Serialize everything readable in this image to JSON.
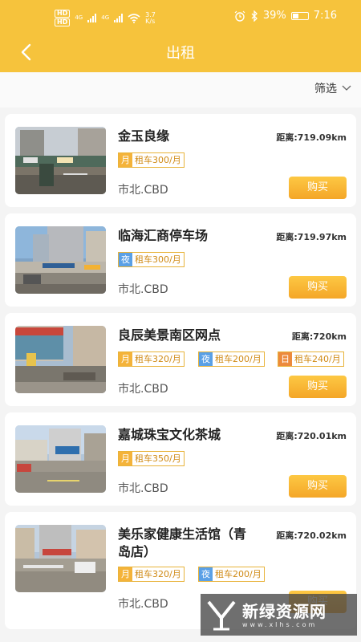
{
  "status_bar": {
    "sim1": "HD",
    "sim2": "HD",
    "net1": "4G",
    "net2": "4G",
    "speed_value": "3.7",
    "speed_unit": "K/s",
    "battery": "39%",
    "time": "7:16",
    "icons": [
      "alarm-icon",
      "bluetooth-icon",
      "battery-icon",
      "wifi-icon",
      "signal-icon"
    ]
  },
  "header": {
    "title": "出租",
    "back_icon": "chevron-left-icon"
  },
  "filter": {
    "label": "筛选",
    "icon": "chevron-down-icon"
  },
  "listings": [
    {
      "name": "金玉良缘",
      "distance": "距离:719.09km",
      "tags": [
        {
          "type": "月",
          "text": "租车300/月",
          "color": "#f4b33a"
        }
      ],
      "location": "市北.CBD",
      "button": "购买"
    },
    {
      "name": "临海汇商停车场",
      "distance": "距离:719.97km",
      "tags": [
        {
          "type": "夜",
          "text": "租车300/月",
          "color": "#5aa0e6"
        }
      ],
      "location": "市北.CBD",
      "button": "购买"
    },
    {
      "name": "良辰美景南区网点",
      "distance": "距离:720km",
      "tags": [
        {
          "type": "月",
          "text": "租车320/月",
          "color": "#f4b33a"
        },
        {
          "type": "夜",
          "text": "租车200/月",
          "color": "#5aa0e6"
        },
        {
          "type": "日",
          "text": "租车240/月",
          "color": "#ec8a3c"
        }
      ],
      "location": "市北.CBD",
      "button": "购买"
    },
    {
      "name": "嘉城珠宝文化茶城",
      "distance": "距离:720.01km",
      "tags": [
        {
          "type": "月",
          "text": "租车350/月",
          "color": "#f4b33a"
        }
      ],
      "location": "市北.CBD",
      "button": "购买"
    },
    {
      "name_line1": "美乐家健康生活馆（青",
      "name_line2": "岛店）",
      "distance": "距离:720.02km",
      "tags": [
        {
          "type": "月",
          "text": "租车320/月",
          "color": "#f4b33a"
        },
        {
          "type": "夜",
          "text": "租车200/月",
          "color": "#5aa0e6"
        }
      ],
      "location": "市北.CBD",
      "button": "购买"
    }
  ],
  "watermark": {
    "text": "新绿资源网",
    "url": "www.xlhs.com"
  }
}
